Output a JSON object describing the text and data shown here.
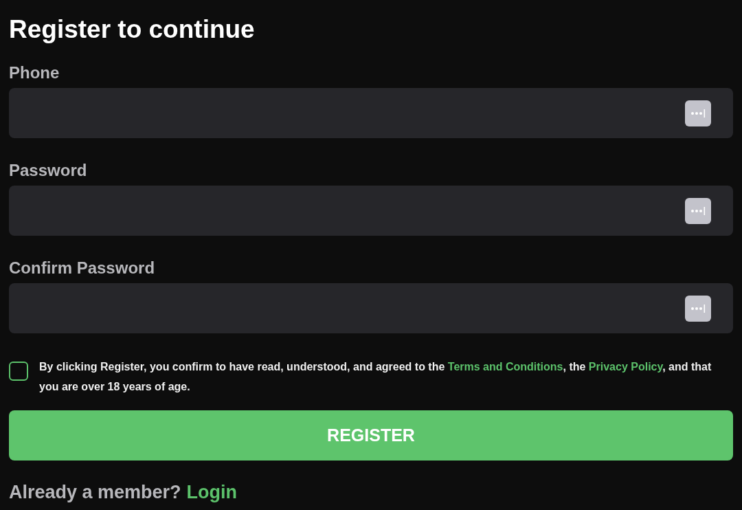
{
  "title": "Register to continue",
  "fields": [
    {
      "label": "Phone"
    },
    {
      "label": "Password"
    },
    {
      "label": "Confirm Password"
    }
  ],
  "agreement": {
    "checked": false,
    "parts": [
      {
        "kind": "text",
        "text": "By clicking Register, you confirm to have read, understood, and agreed to the "
      },
      {
        "kind": "link",
        "text": "Terms and Conditions"
      },
      {
        "kind": "text",
        "text": ", the "
      },
      {
        "kind": "link",
        "text": "Privacy Policy"
      },
      {
        "kind": "text",
        "text": ", and that you are over 18 years of age."
      }
    ]
  },
  "register_button": "REGISTER",
  "footer": {
    "prompt": "Already a member?",
    "link": "Login"
  }
}
